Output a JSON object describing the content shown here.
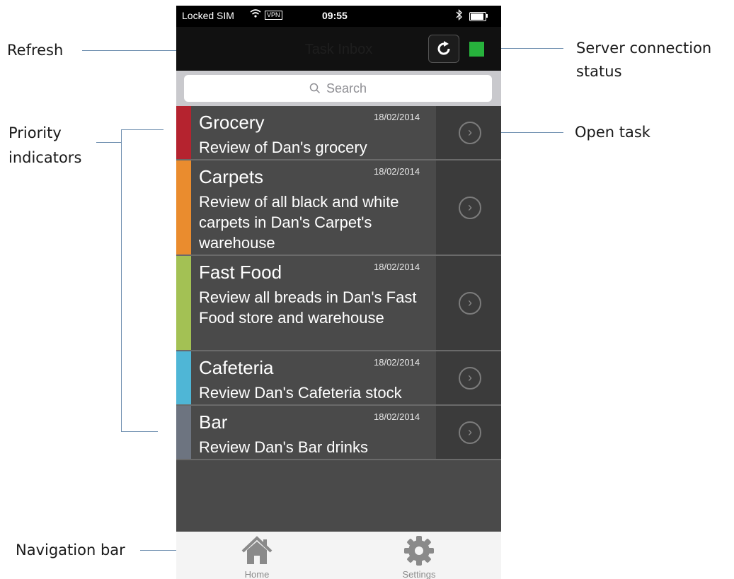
{
  "annotations": {
    "refresh": "Refresh",
    "server_line1": "Server connection",
    "server_line2": "status",
    "priority_line1": "Priority",
    "priority_line2": "indicators",
    "open_task": "Open task",
    "navigation_bar": "Navigation bar"
  },
  "status_bar": {
    "carrier": "Locked SIM",
    "vpn": "VPN",
    "time": "09:55"
  },
  "nav": {
    "title": "Task Inbox",
    "connection_status_color": "#27b23c"
  },
  "search": {
    "placeholder": "Search"
  },
  "tasks": [
    {
      "title": "Grocery",
      "date": "18/02/2014",
      "description": "Review of Dan's grocery",
      "priority_color": "#b5232f"
    },
    {
      "title": "Carpets",
      "date": "18/02/2014",
      "description": "Review of all black and white carpets in Dan's Carpet's warehouse",
      "priority_color": "#ea8c2e"
    },
    {
      "title": "Fast Food",
      "date": "18/02/2014",
      "description": "Review all breads in Dan's Fast Food store and warehouse",
      "priority_color": "#a3c154"
    },
    {
      "title": "Cafeteria",
      "date": "18/02/2014",
      "description": "Review Dan's Cafeteria stock",
      "priority_color": "#4fb6d6"
    },
    {
      "title": "Bar",
      "date": "18/02/2014",
      "description": "Review Dan's Bar drinks",
      "priority_color": "#6d7480"
    }
  ],
  "tabbar": {
    "home": "Home",
    "settings": "Settings"
  }
}
